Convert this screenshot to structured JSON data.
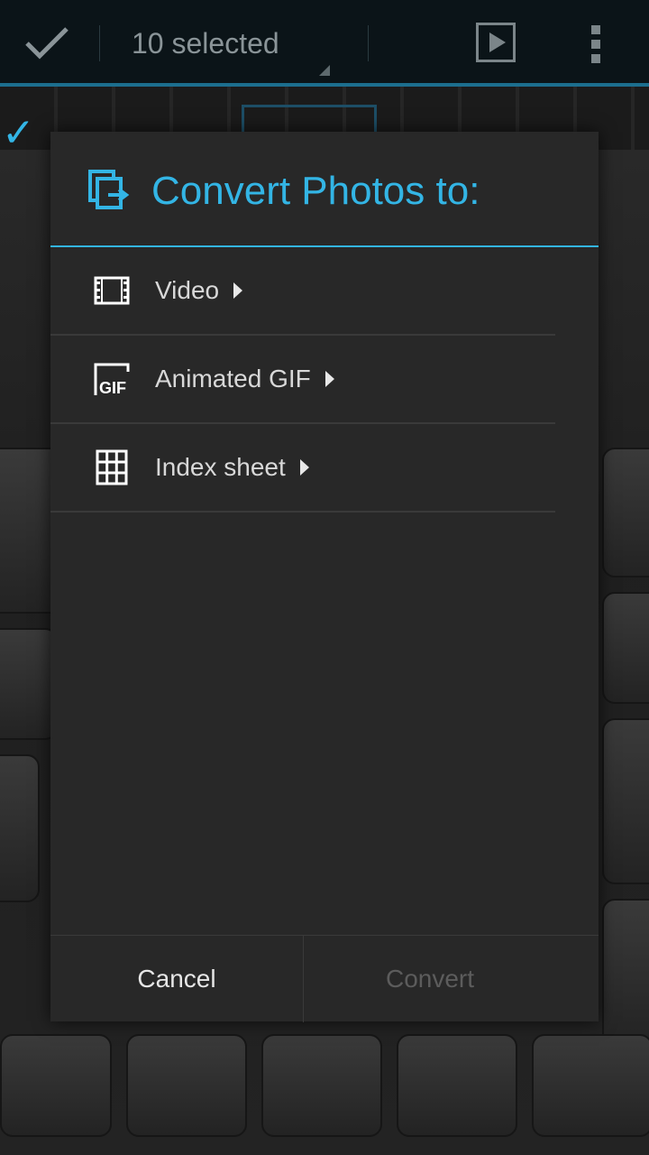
{
  "action_bar": {
    "title": "10 selected",
    "done_icon": "check-icon",
    "slideshow_icon": "play-icon",
    "overflow_icon": "overflow-menu-icon"
  },
  "dialog": {
    "title": "Convert Photos to:",
    "title_icon": "convert-icon",
    "options": [
      {
        "label": "Video",
        "icon": "film-icon"
      },
      {
        "label": "Animated GIF",
        "icon": "gif-icon"
      },
      {
        "label": "Index sheet",
        "icon": "grid-icon"
      }
    ],
    "buttons": {
      "cancel": "Cancel",
      "convert": "Convert"
    }
  },
  "colors": {
    "accent": "#33b5e5",
    "dialog_bg": "#282828",
    "disabled_text": "#5c5c5c"
  }
}
